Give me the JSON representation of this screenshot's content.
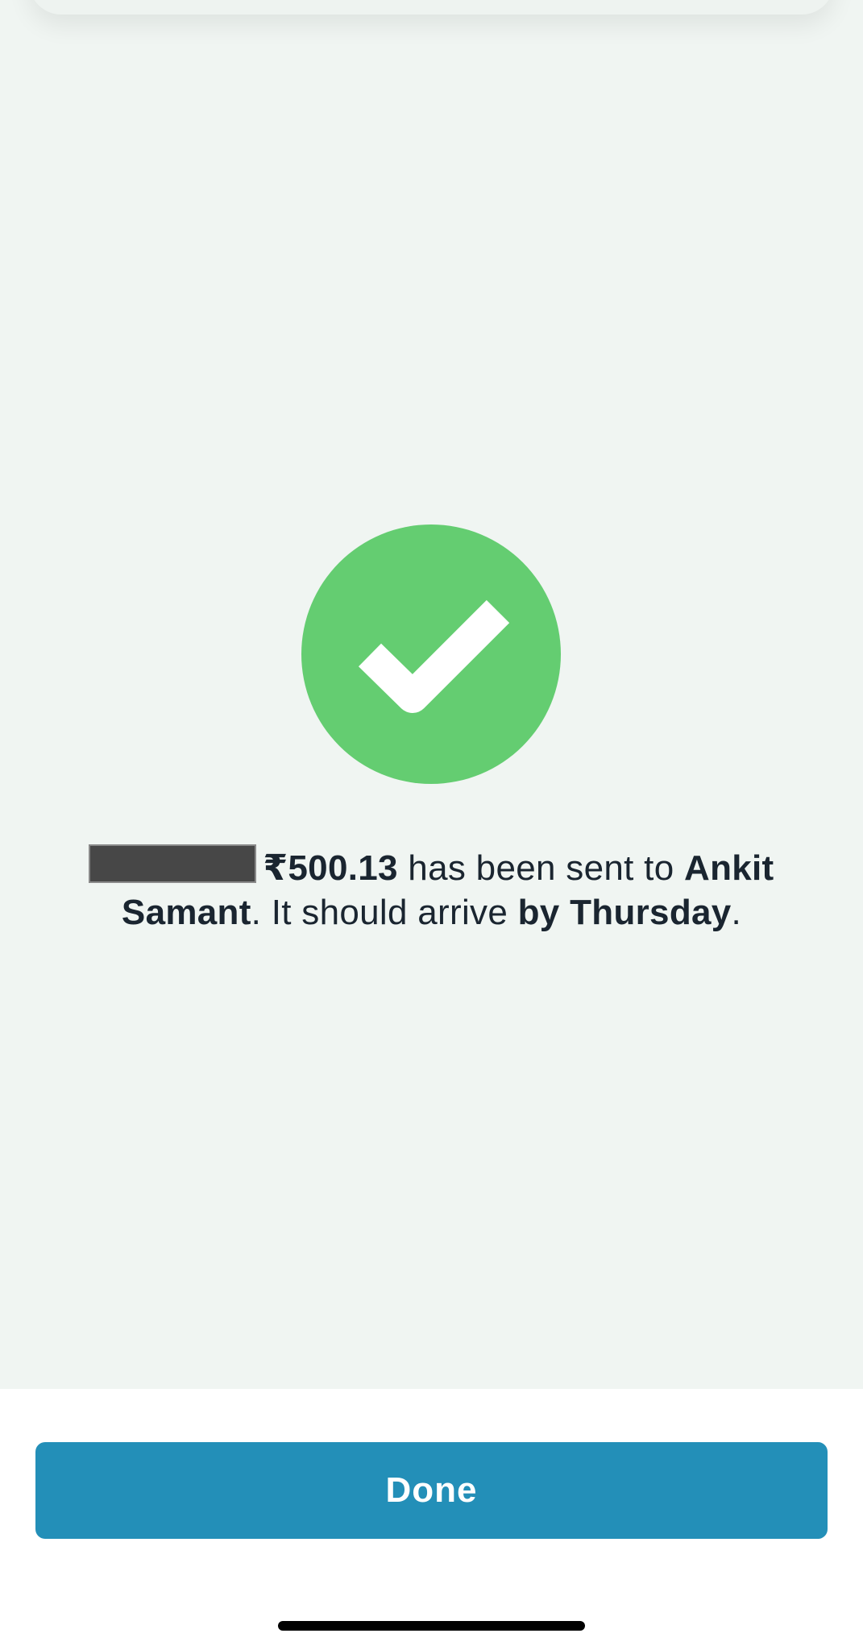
{
  "status": {
    "icon": "checkmark-circle-icon",
    "color": "#64cd71"
  },
  "message": {
    "amount": "₹500.13",
    "text_sent_to": " has been sent to ",
    "recipient": "Ankit Samant",
    "text_arrive": ". It should arrive ",
    "arrival": "by Thursday",
    "text_end": "."
  },
  "actions": {
    "done_label": "Done",
    "done_color": "#238fb8"
  }
}
